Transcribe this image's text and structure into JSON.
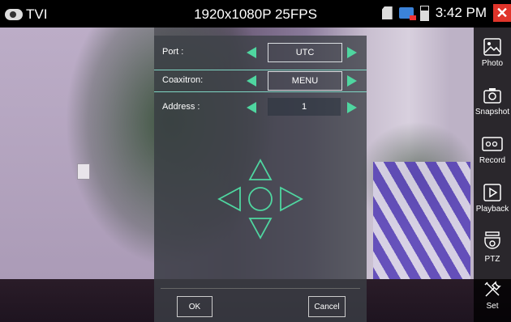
{
  "statusbar": {
    "mode_label": "TVI",
    "resolution": "1920x1080P 25FPS",
    "time": "3:42 PM"
  },
  "sidebar": {
    "items": [
      {
        "label": "Photo",
        "icon": "photo-icon"
      },
      {
        "label": "Snapshot",
        "icon": "camera-icon"
      },
      {
        "label": "Record",
        "icon": "record-icon"
      },
      {
        "label": "Playback",
        "icon": "playback-icon"
      },
      {
        "label": "PTZ",
        "icon": "ptz-camera-icon"
      },
      {
        "label": "Set",
        "icon": "tools-icon"
      }
    ]
  },
  "dialog": {
    "rows": [
      {
        "label": "Port :",
        "value": "UTC"
      },
      {
        "label": "Coaxitron:",
        "value": "MENU"
      },
      {
        "label": "Address :",
        "value": "1"
      }
    ],
    "ok_label": "OK",
    "cancel_label": "Cancel"
  },
  "colors": {
    "accent": "#4fd6a0",
    "close": "#e0342a"
  }
}
